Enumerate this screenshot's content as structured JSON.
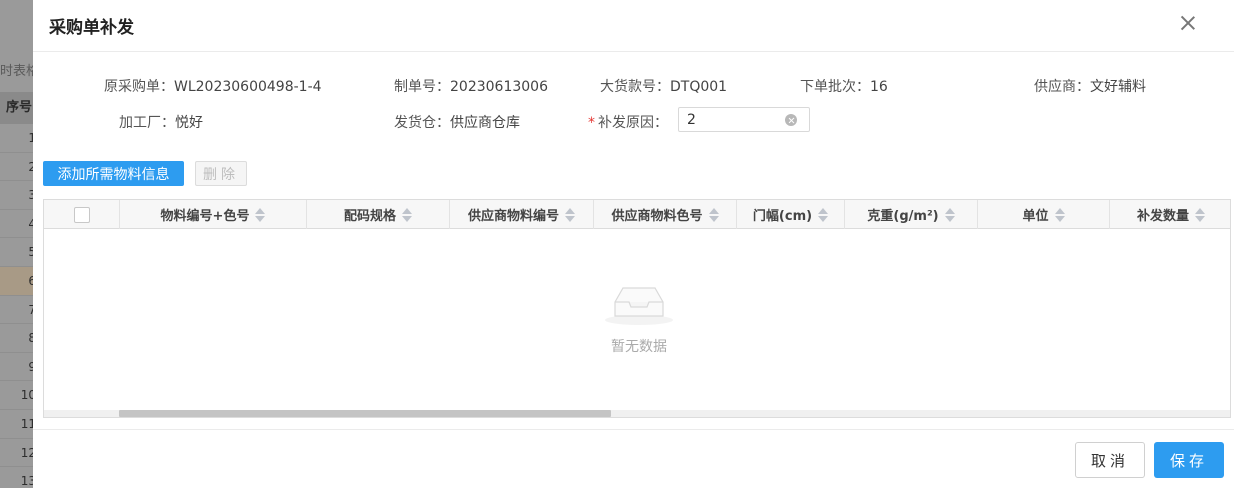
{
  "background": {
    "toolbar_text": "时表格",
    "header_label": "序号",
    "row_numbers": [
      "1",
      "2",
      "3",
      "4",
      "5",
      "6",
      "7",
      "8",
      "9",
      "10",
      "11",
      "12",
      "13"
    ]
  },
  "dialog": {
    "title": "采购单补发",
    "close_icon": "close-icon"
  },
  "info": {
    "purchase_order": {
      "label": "原采购单：",
      "value": "WL20230600498-1-4"
    },
    "order_number": {
      "label": "制单号：",
      "value": "20230613006"
    },
    "bulk_style_number": {
      "label": "大货款号：",
      "value": "DTQ001"
    },
    "order_batch": {
      "label": "下单批次：",
      "value": "16"
    },
    "supplier": {
      "label": "供应商：",
      "value": "文好辅料"
    },
    "factory": {
      "label": "加工厂：",
      "value": "悦好"
    },
    "shipping_warehouse": {
      "label": "发货仓：",
      "value": "供应商仓库"
    },
    "reissue_reason": {
      "required_mark": "*",
      "label": "补发原因：",
      "value": "2"
    }
  },
  "toolbar": {
    "add_label": "添加所需物料信息",
    "delete_label": "删除"
  },
  "table": {
    "columns": [
      "物料编号+色号",
      "配码规格",
      "供应商物料编号",
      "供应商物料色号",
      "门幅(cm)",
      "克重(g/m²)",
      "单位",
      "补发数量"
    ],
    "rows": [],
    "empty_text": "暂无数据"
  },
  "footer": {
    "cancel_label": "取消",
    "save_label": "保存"
  },
  "colors": {
    "primary": "#2d9cf0",
    "required": "#e53935"
  }
}
